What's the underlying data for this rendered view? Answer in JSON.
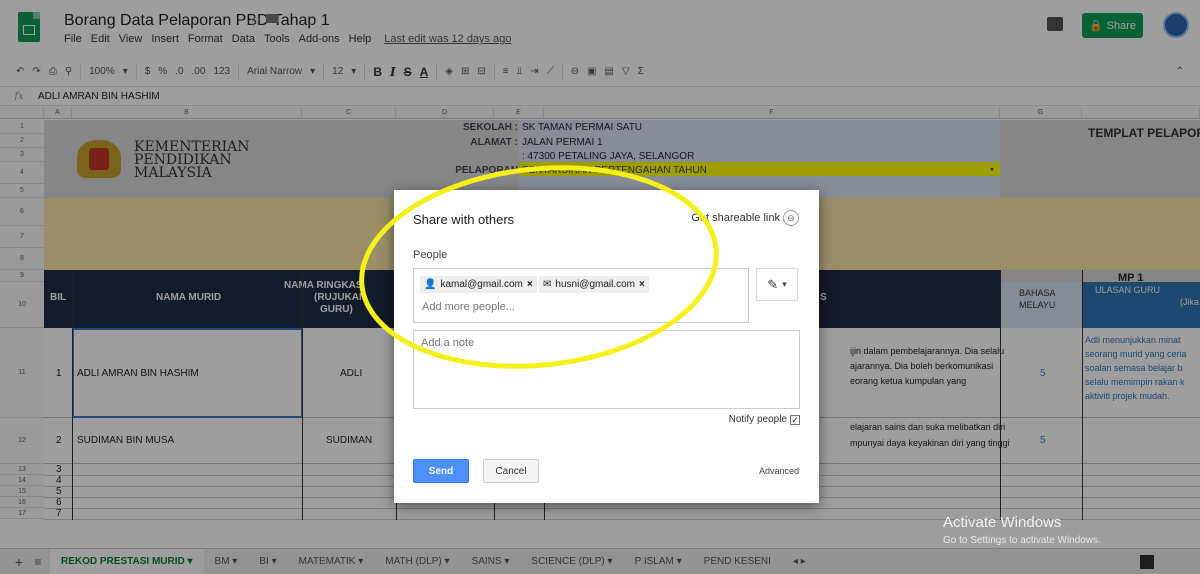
{
  "document": {
    "title": "Borang Data Pelaporan PBD Tahap 1",
    "last_edit": "Last edit was 12 days ago",
    "menu": [
      "File",
      "Edit",
      "View",
      "Insert",
      "Format",
      "Data",
      "Tools",
      "Add-ons",
      "Help"
    ],
    "share_label": "Share"
  },
  "toolbar": {
    "zoom": "100%",
    "currency": "$",
    "percent": "%",
    "decimal_less": ".0",
    "decimal_more": ".00",
    "number_format": "123",
    "font": "Arial Narrow",
    "font_size": "12",
    "bold": "B",
    "italic": "I",
    "strike": "S",
    "text_color": "A"
  },
  "formula_bar": {
    "value": "ADLI AMRAN BIN HASHIM"
  },
  "columns": [
    "A",
    "B",
    "C",
    "D",
    "E",
    "F",
    "G"
  ],
  "rows": [
    "1",
    "2",
    "3",
    "4",
    "5",
    "6",
    "7",
    "8",
    "9",
    "10",
    "11",
    "12",
    "13",
    "14",
    "15",
    "16",
    "17"
  ],
  "sheet": {
    "ministry_line1": "KEMENTERIAN",
    "ministry_line2": "PENDIDIKAN",
    "ministry_line3": "MALAYSIA",
    "sekolah_label": "SEKOLAH :",
    "sekolah_value": "SK TAMAN PERMAI SATU",
    "alamat_label": "ALAMAT :",
    "alamat_value1": "JALAN PERMAI 1",
    "alamat_value2": ": 47300 PETALING JAYA, SELANGOR",
    "pelaporan_label_tail": "PELAPORAN",
    "pelaporan_value": "PENTAKSIRAN PERTENGAHAN TAHUN",
    "templat": "TEMPLAT PELAPORAN",
    "header_bil": "BIL",
    "header_nama": "NAMA MURID",
    "header_ringkas1": "NAMA RINGKAS",
    "header_ringkas2": "(RUJUKAN",
    "header_ringkas3": "GURU)",
    "header_s": "S",
    "header_mp1": "MP 1",
    "header_bm1": "BAHASA",
    "header_bm2": "MELAYU",
    "header_ulasan": "ULASAN GURU",
    "header_jika": "(Jika",
    "students": [
      {
        "bil": "1",
        "nama": "ADLI AMRAN BIN HASHIM",
        "ringkas": "ADLI",
        "bm": "5",
        "comment1": "ijin dalam pembelajarannya. Dia selalu",
        "comment2": "ajarannya. Dia boleh berkomunikasi",
        "comment3": "eorang ketua kumpulan yang",
        "ulasan1": "Adli menunjukkan minat",
        "ulasan2": "seorang murid yang ceria",
        "ulasan3": "soalan semasa belajar b",
        "ulasan4": "selalu memimpin rakan k",
        "ulasan5": "aktiviti projek mudah."
      },
      {
        "bil": "2",
        "nama": "SUDIMAN BIN MUSA",
        "ringkas": "SUDIMAN",
        "bm": "5",
        "comment1": "elajaran sains dan suka melibatkan diri",
        "comment2": "mpunyai daya keyakinan diri yang tinggi"
      }
    ],
    "empty_bil": [
      "3",
      "4",
      "5",
      "6",
      "7"
    ]
  },
  "dialog": {
    "title": "Share with others",
    "shareable_link": "Get shareable link",
    "people_label": "People",
    "chips": [
      {
        "email": "kamal@gmail.com",
        "icon": "person-icon"
      },
      {
        "email": "husni@gmail.com",
        "icon": "mail-icon"
      }
    ],
    "add_more_placeholder": "Add more people...",
    "note_placeholder": "Add a note",
    "notify_label": "Notify people",
    "send_label": "Send",
    "cancel_label": "Cancel",
    "advanced_label": "Advanced"
  },
  "tabs": [
    "REKOD PRESTASI MURID",
    "BM",
    "BI",
    "MATEMATIK",
    "MATH (DLP)",
    "SAINS",
    "SCIENCE (DLP)",
    "P ISLAM",
    "PEND KESENI"
  ],
  "watermark": {
    "line1": "Activate Windows",
    "line2": "Go to Settings to activate Windows."
  },
  "colors": {
    "accent": "#0f9d58",
    "send": "#4d90fe",
    "highlight": "#f5f01b",
    "header_dark": "#1f2a44"
  }
}
